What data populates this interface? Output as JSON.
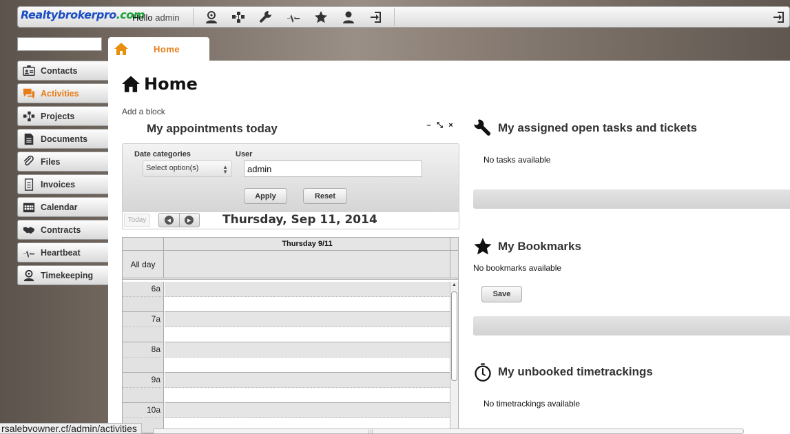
{
  "header": {
    "logo_main": "Realtybrokerpro",
    "logo_tld": ".com",
    "greeting": "Hello",
    "username": "admin",
    "toolbar_icons": [
      "contacts-person-icon",
      "projects-icon",
      "wrench-icon",
      "heartbeat-icon",
      "star-icon",
      "user-icon",
      "logout-icon"
    ]
  },
  "search": {
    "value": "",
    "placeholder": ""
  },
  "sidebar": {
    "items": [
      {
        "label": "Contacts",
        "icon": "contact-card-icon"
      },
      {
        "label": "Activities",
        "icon": "speech-bubble-icon",
        "active": true
      },
      {
        "label": "Projects",
        "icon": "projects-icon"
      },
      {
        "label": "Documents",
        "icon": "document-icon"
      },
      {
        "label": "Files",
        "icon": "paperclip-icon"
      },
      {
        "label": "Invoices",
        "icon": "invoice-icon"
      },
      {
        "label": "Calendar",
        "icon": "calendar-icon"
      },
      {
        "label": "Contracts",
        "icon": "handshake-icon"
      },
      {
        "label": "Heartbeat",
        "icon": "heartbeat-icon"
      },
      {
        "label": "Timekeeping",
        "icon": "stopwatch-icon"
      }
    ]
  },
  "tab": {
    "label": "Home"
  },
  "main": {
    "title": "Home",
    "add_block": "Add a block"
  },
  "appointments": {
    "title": "My appointments today",
    "controls": [
      "–",
      "⤡",
      "×"
    ],
    "filter": {
      "date_categories_label": "Date categories",
      "date_categories_value": "Select option(s)",
      "user_label": "User",
      "user_value": "admin",
      "apply": "Apply",
      "reset": "Reset"
    },
    "calendar": {
      "today": "Today",
      "date": "Thursday, Sep 11, 2014",
      "day_header": "Thursday 9/11",
      "all_day": "All day",
      "hours": [
        "6a",
        "7a",
        "8a",
        "9a",
        "10a"
      ]
    }
  },
  "tasks": {
    "title": "My assigned open tasks and tickets",
    "empty": "No tasks available"
  },
  "bookmarks": {
    "title": "My Bookmarks",
    "empty": "No bookmarks available",
    "save": "Save"
  },
  "timetrackings": {
    "title": "My unbooked timetrackings",
    "empty": "No timetrackings available"
  },
  "status": {
    "url": "rsalebvowner.cf/admin/activities"
  }
}
